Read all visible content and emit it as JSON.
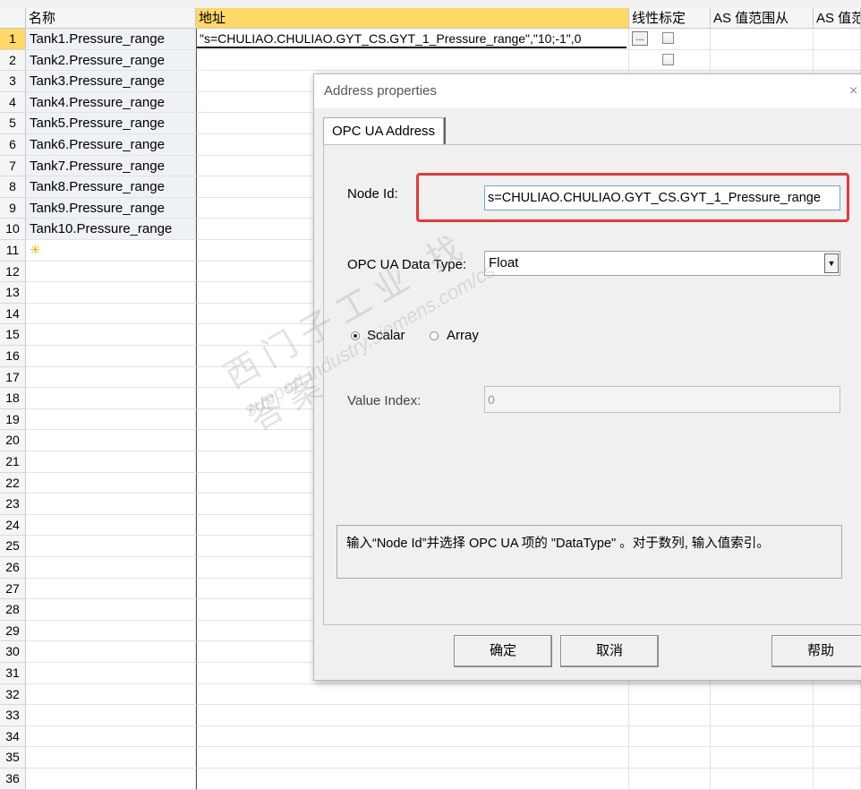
{
  "columns": {
    "name": "名称",
    "address": "地址",
    "linear": "线性标定",
    "as_from": "AS 值范围从",
    "as_to": "AS 值范"
  },
  "rows": [
    {
      "num": "1",
      "name": "Tank1.Pressure_range",
      "address": "\"s=CHULIAO.CHULIAO.GYT_CS.GYT_1_Pressure_range\",\"10;-1\",0"
    },
    {
      "num": "2",
      "name": "Tank2.Pressure_range",
      "address": ""
    },
    {
      "num": "3",
      "name": "Tank3.Pressure_range",
      "address": ""
    },
    {
      "num": "4",
      "name": "Tank4.Pressure_range",
      "address": ""
    },
    {
      "num": "5",
      "name": "Tank5.Pressure_range",
      "address": ""
    },
    {
      "num": "6",
      "name": "Tank6.Pressure_range",
      "address": ""
    },
    {
      "num": "7",
      "name": "Tank7.Pressure_range",
      "address": ""
    },
    {
      "num": "8",
      "name": "Tank8.Pressure_range",
      "address": ""
    },
    {
      "num": "9",
      "name": "Tank9.Pressure_range",
      "address": ""
    },
    {
      "num": "10",
      "name": "Tank10.Pressure_range",
      "address": ""
    },
    {
      "num": "11",
      "name": "",
      "address": ""
    },
    {
      "num": "12",
      "name": "",
      "address": ""
    },
    {
      "num": "13",
      "name": "",
      "address": ""
    },
    {
      "num": "14",
      "name": "",
      "address": ""
    },
    {
      "num": "15",
      "name": "",
      "address": ""
    },
    {
      "num": "16",
      "name": "",
      "address": ""
    },
    {
      "num": "17",
      "name": "",
      "address": ""
    },
    {
      "num": "18",
      "name": "",
      "address": ""
    },
    {
      "num": "19",
      "name": "",
      "address": ""
    },
    {
      "num": "20",
      "name": "",
      "address": ""
    },
    {
      "num": "21",
      "name": "",
      "address": ""
    },
    {
      "num": "22",
      "name": "",
      "address": ""
    },
    {
      "num": "23",
      "name": "",
      "address": ""
    },
    {
      "num": "24",
      "name": "",
      "address": ""
    },
    {
      "num": "25",
      "name": "",
      "address": ""
    },
    {
      "num": "26",
      "name": "",
      "address": ""
    },
    {
      "num": "27",
      "name": "",
      "address": ""
    },
    {
      "num": "28",
      "name": "",
      "address": ""
    },
    {
      "num": "29",
      "name": "",
      "address": ""
    },
    {
      "num": "30",
      "name": "",
      "address": ""
    },
    {
      "num": "31",
      "name": "",
      "address": ""
    },
    {
      "num": "32",
      "name": "",
      "address": ""
    },
    {
      "num": "33",
      "name": "",
      "address": ""
    },
    {
      "num": "34",
      "name": "",
      "address": ""
    },
    {
      "num": "35",
      "name": "",
      "address": ""
    },
    {
      "num": "36",
      "name": "",
      "address": ""
    }
  ],
  "new_row_icon": "asterisk-icon",
  "browse_button_label": "...",
  "dialog": {
    "title": "Address properties",
    "close": "×",
    "tab": "OPC UA Address",
    "node_id_label": "Node Id:",
    "node_id_value": "s=CHULIAO.CHULIAO.GYT_CS.GYT_1_Pressure_range",
    "data_type_label": "OPC UA Data Type:",
    "data_type_value": "Float",
    "scalar_label": "Scalar",
    "array_label": "Array",
    "selected_mode": "Scalar",
    "value_index_label": "Value Index:",
    "value_index_value": "0",
    "help_text": "输入“Node Id”并选择 OPC UA 项的 \"DataType\" 。对于数列, 输入值索引。",
    "ok": "确定",
    "cancel": "取消",
    "help": "帮助"
  },
  "watermark": {
    "line1": "西门子工业  找答案",
    "line2": "support.industry.siemens.com/cs"
  },
  "colors": {
    "selected_header": "#ffd966",
    "highlight_border": "#e53935"
  }
}
